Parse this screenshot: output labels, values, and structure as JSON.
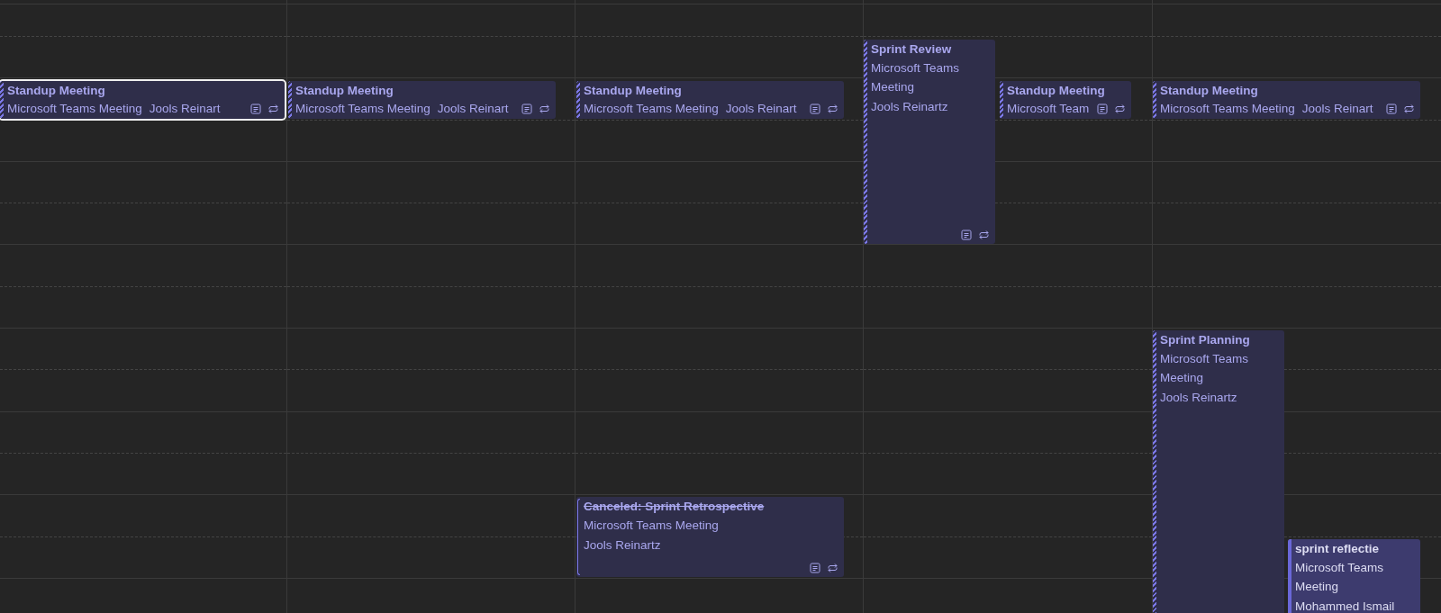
{
  "days": [
    {
      "events": [
        {
          "kind": "compact",
          "title": "Standup Meeting",
          "location": "Microsoft Teams Meeting",
          "organizer": "Jools Reinart",
          "tentative": true,
          "canceled": false,
          "selected": true,
          "has_notes": true,
          "recurring": true
        }
      ]
    },
    {
      "events": [
        {
          "kind": "compact",
          "title": "Standup Meeting",
          "location": "Microsoft Teams Meeting",
          "organizer": "Jools Reinart",
          "tentative": true,
          "canceled": false,
          "selected": false,
          "has_notes": true,
          "recurring": true
        }
      ]
    },
    {
      "events": [
        {
          "kind": "compact",
          "title": "Standup Meeting",
          "location": "Microsoft Teams Meeting",
          "organizer": "Jools Reinart",
          "tentative": true,
          "canceled": false,
          "selected": false,
          "has_notes": true,
          "recurring": true
        },
        {
          "kind": "tall",
          "title": "Canceled: Sprint Retrospective",
          "location": "Microsoft Teams Meeting",
          "organizer": "Jools Reinartz",
          "tentative": false,
          "canceled": true,
          "selected": false,
          "has_notes": true,
          "recurring": true
        }
      ]
    },
    {
      "events": [
        {
          "kind": "tall",
          "title": "Sprint Review",
          "location": "Microsoft Teams Meeting",
          "organizer": "Jools Reinartz",
          "tentative": true,
          "canceled": false,
          "selected": false,
          "has_notes": true,
          "recurring": true
        },
        {
          "kind": "compact",
          "title": "Standup Meeting",
          "location": "Microsoft Team",
          "tentative": true,
          "canceled": false,
          "selected": false,
          "has_notes": true,
          "recurring": true
        }
      ]
    },
    {
      "events": [
        {
          "kind": "compact",
          "title": "Standup Meeting",
          "location": "Microsoft Teams Meeting",
          "organizer": "Jools Reinart",
          "tentative": true,
          "canceled": false,
          "selected": false,
          "has_notes": true,
          "recurring": true
        },
        {
          "kind": "tall",
          "title": "Sprint Planning",
          "location": "Microsoft Teams Meeting",
          "organizer": "Jools Reinartz",
          "tentative": true,
          "canceled": false,
          "selected": false
        },
        {
          "kind": "tall",
          "title": "sprint reflectie",
          "location": "Microsoft Teams Meeting",
          "organizer": "Mohammed Ismail",
          "tentative": false,
          "canceled": false,
          "selected": false
        }
      ]
    }
  ]
}
